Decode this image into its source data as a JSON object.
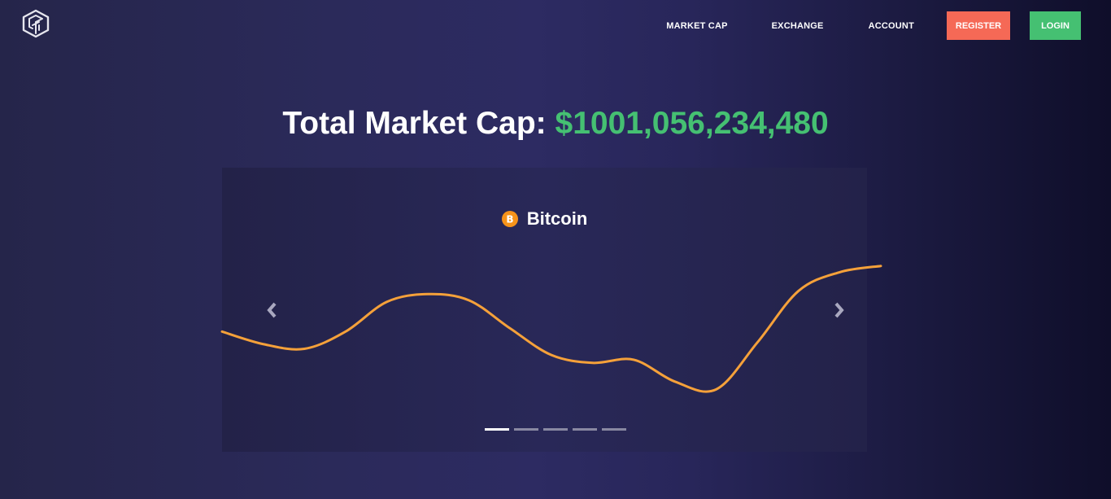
{
  "nav": {
    "logo_icon": "cube-logo-icon",
    "links": [
      "MARKET CAP",
      "EXCHANGE",
      "ACCOUNT"
    ],
    "register_label": "REGISTER",
    "login_label": "LOGIN",
    "register_color": "#f56956",
    "login_color": "#45c072"
  },
  "hero": {
    "label": "Total Market Cap:",
    "value": "$1001,056,234,480",
    "value_color": "#45c072"
  },
  "carousel": {
    "coin_name": "Bitcoin",
    "coin_icon": "bitcoin-icon",
    "coin_color": "#f7931a",
    "line_color": "#f5a13a",
    "prev_icon": "chevron-left-icon",
    "next_icon": "chevron-right-icon",
    "slide_count": 5,
    "active_slide": 0
  },
  "chart_data": {
    "type": "line",
    "series": [
      {
        "color": "#f5a13a",
        "x": [
          0,
          1,
          2,
          3,
          4,
          5,
          6,
          7,
          8,
          9,
          10,
          11,
          12,
          13,
          14,
          15,
          16
        ],
        "values": [
          0.42,
          0.34,
          0.31,
          0.42,
          0.61,
          0.66,
          0.62,
          0.44,
          0.27,
          0.22,
          0.24,
          0.1,
          0.05,
          0.35,
          0.68,
          0.8,
          0.84
        ]
      }
    ],
    "xlim": [
      0,
      16
    ],
    "ylim": [
      0,
      1
    ],
    "grid": false,
    "legend": "none"
  }
}
